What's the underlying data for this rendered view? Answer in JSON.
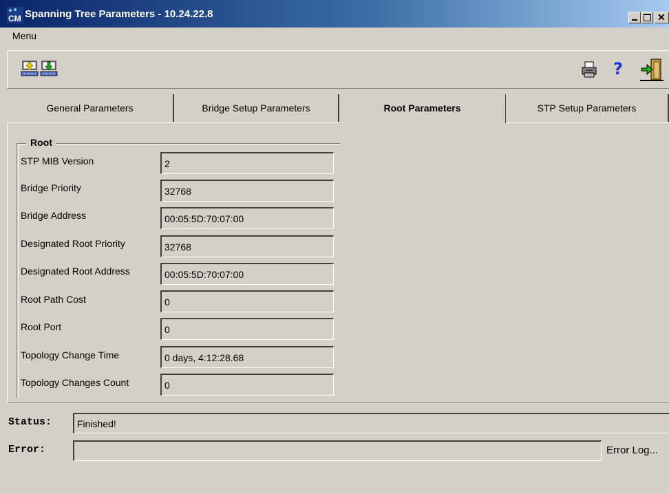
{
  "window": {
    "app_icon_text": "CM",
    "title": "Spanning Tree Parameters  - 10.24.22.8"
  },
  "menu": {
    "label": "Menu"
  },
  "toolbar": {
    "icons": [
      "upload-icon",
      "download-icon",
      "print-icon",
      "help-icon",
      "exit-icon"
    ],
    "help_glyph": "?"
  },
  "tabs": [
    {
      "label": "General Parameters",
      "active": false
    },
    {
      "label": "Bridge Setup Parameters",
      "active": false
    },
    {
      "label": "Root Parameters",
      "active": true
    },
    {
      "label": "STP Setup Parameters",
      "active": false
    }
  ],
  "root_group": {
    "legend": "Root",
    "fields": [
      {
        "label": "STP MIB Version",
        "value": "2"
      },
      {
        "label": "Bridge Priority",
        "value": "32768"
      },
      {
        "label": "Bridge Address",
        "value": "00:05:5D:70:07:00"
      },
      {
        "label": "Designated Root Priority",
        "value": "32768"
      },
      {
        "label": "Designated Root Address",
        "value": "00:05:5D:70:07:00"
      },
      {
        "label": "Root Path Cost",
        "value": "0"
      },
      {
        "label": "Root Port",
        "value": "0"
      },
      {
        "label": "Topology Change Time",
        "value": "0 days, 4:12:28.68"
      },
      {
        "label": "Topology Changes Count",
        "value": "0"
      }
    ]
  },
  "status": {
    "status_label": "Status:",
    "status_value": "Finished!",
    "error_label": "Error:",
    "error_value": "",
    "error_log_label": "Error Log..."
  }
}
